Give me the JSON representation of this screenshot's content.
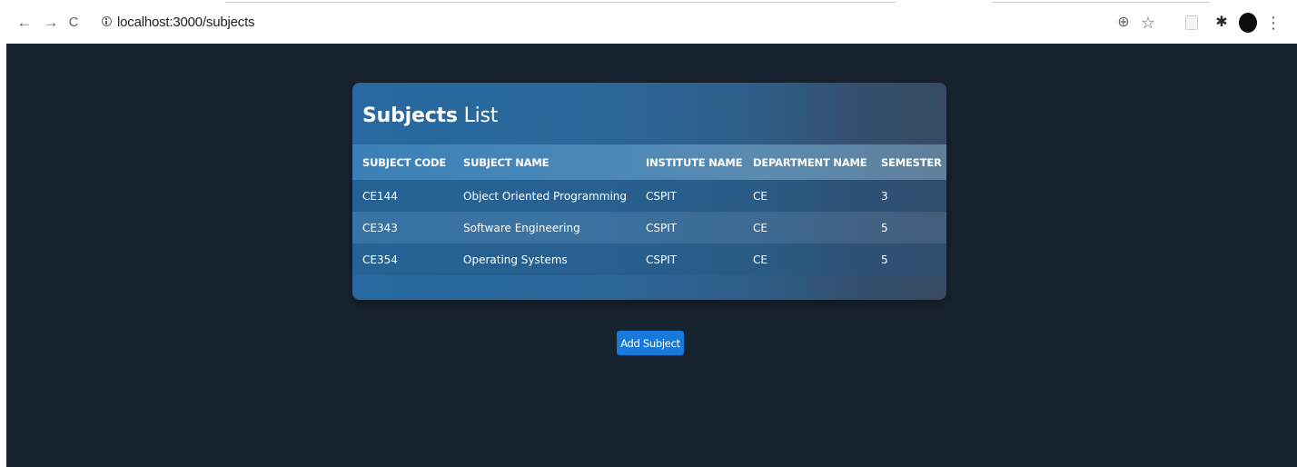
{
  "browser": {
    "url": "localhost:3000/subjects",
    "back_glyph": "←",
    "forward_glyph": "→",
    "reload_glyph": "C",
    "zoom_glyph": "⊕",
    "star_glyph": "☆",
    "puzzle_glyph": "✱",
    "menu_glyph": "⋮"
  },
  "card": {
    "title_bold": "Subjects",
    "title_rest": " List",
    "columns": [
      "SUBJECT CODE",
      "SUBJECT NAME",
      "INSTITUTE NAME",
      "DEPARTMENT NAME",
      "SEMESTER"
    ],
    "rows": [
      [
        "CE144",
        "Object Oriented Programming",
        "CSPIT",
        "CE",
        "3"
      ],
      [
        "CE343",
        "Software Engineering",
        "CSPIT",
        "CE",
        "5"
      ],
      [
        "CE354",
        "Operating Systems",
        "CSPIT",
        "CE",
        "5"
      ]
    ]
  },
  "actions": {
    "add_label": "Add Subject"
  },
  "colors": {
    "page_background": "#17232f",
    "accent_button": "#1879db"
  }
}
